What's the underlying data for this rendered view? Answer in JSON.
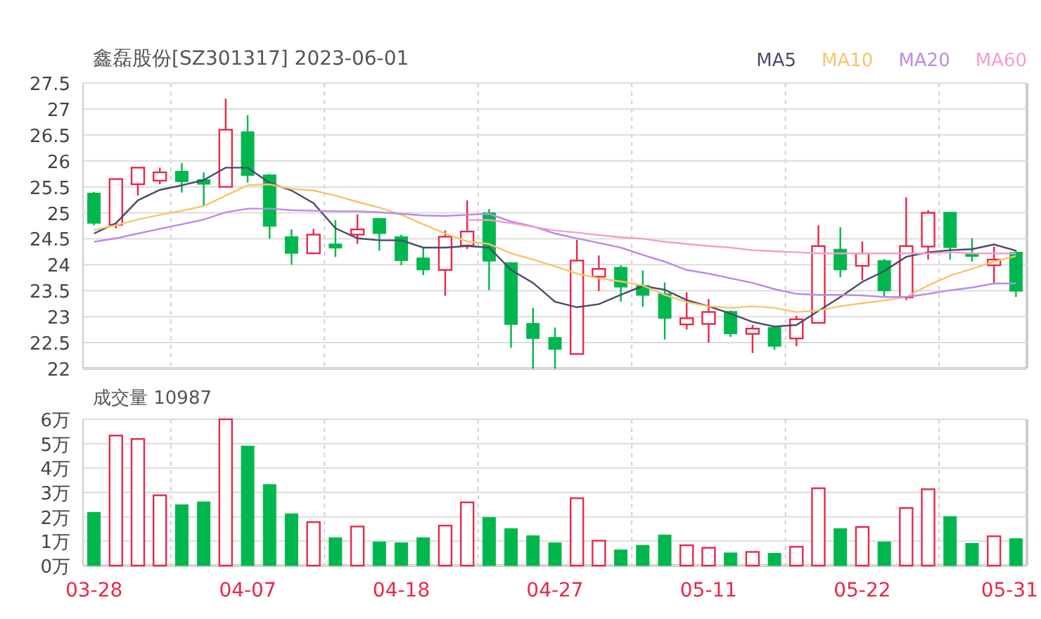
{
  "title": "鑫磊股份[SZ301317] 2023-06-01",
  "price_chart": {
    "chart_data": {
      "type": "candlestick",
      "grid": true,
      "ylim": [
        22,
        27.5
      ],
      "yticks": [
        22,
        22.5,
        23,
        23.5,
        24,
        24.5,
        25,
        25.5,
        26,
        26.5,
        27,
        27.5
      ],
      "categories": [
        null,
        null,
        null,
        null,
        null,
        null,
        null,
        null,
        null,
        null,
        null,
        null,
        null,
        null,
        null,
        null,
        null,
        null,
        null,
        null,
        null,
        null,
        null,
        null,
        null,
        null,
        null,
        null,
        null,
        null,
        null,
        null,
        null,
        null,
        null,
        null,
        null,
        null,
        null,
        null,
        null,
        null,
        null
      ],
      "ohlc": [
        [
          25.38,
          25.4,
          24.76,
          24.8
        ],
        [
          24.77,
          25.66,
          24.7,
          25.65
        ],
        [
          25.55,
          25.88,
          25.33,
          25.87
        ],
        [
          25.62,
          25.87,
          25.55,
          25.78
        ],
        [
          25.8,
          25.96,
          25.39,
          25.6
        ],
        [
          25.64,
          25.78,
          25.13,
          25.55
        ],
        [
          25.5,
          27.2,
          25.5,
          26.6
        ],
        [
          26.56,
          26.88,
          25.58,
          25.72
        ],
        [
          25.73,
          25.75,
          24.5,
          24.74
        ],
        [
          24.54,
          24.68,
          24.0,
          24.22
        ],
        [
          24.22,
          24.69,
          24.22,
          24.58
        ],
        [
          24.4,
          24.86,
          24.15,
          24.32
        ],
        [
          24.58,
          24.97,
          24.4,
          24.68
        ],
        [
          24.89,
          24.9,
          24.27,
          24.6
        ],
        [
          24.54,
          24.58,
          23.99,
          24.08
        ],
        [
          24.13,
          24.33,
          23.8,
          23.9
        ],
        [
          23.9,
          24.66,
          23.4,
          24.54
        ],
        [
          24.37,
          25.24,
          24.3,
          24.64
        ],
        [
          25.0,
          25.07,
          23.51,
          24.07
        ],
        [
          24.04,
          24.04,
          22.4,
          22.85
        ],
        [
          22.87,
          23.17,
          22.0,
          22.58
        ],
        [
          22.6,
          22.79,
          22.0,
          22.37
        ],
        [
          22.28,
          24.48,
          22.28,
          24.08
        ],
        [
          23.77,
          24.18,
          23.49,
          23.92
        ],
        [
          23.95,
          23.99,
          23.29,
          23.57
        ],
        [
          23.6,
          23.89,
          23.19,
          23.41
        ],
        [
          23.44,
          23.66,
          22.56,
          22.97
        ],
        [
          22.85,
          23.47,
          22.75,
          22.97
        ],
        [
          22.86,
          23.34,
          22.5,
          23.09
        ],
        [
          23.1,
          23.12,
          22.61,
          22.67
        ],
        [
          22.67,
          22.84,
          22.3,
          22.77
        ],
        [
          22.79,
          22.79,
          22.36,
          22.43
        ],
        [
          22.58,
          23.02,
          22.43,
          22.95
        ],
        [
          22.88,
          24.76,
          22.88,
          24.36
        ],
        [
          24.3,
          24.72,
          23.76,
          23.9
        ],
        [
          23.98,
          24.45,
          23.7,
          24.22
        ],
        [
          24.08,
          24.11,
          23.39,
          23.5
        ],
        [
          23.37,
          25.3,
          23.32,
          24.36
        ],
        [
          24.35,
          25.05,
          24.1,
          25.0
        ],
        [
          25.01,
          25.01,
          24.1,
          24.33
        ],
        [
          24.21,
          24.51,
          24.06,
          24.16
        ],
        [
          23.99,
          24.35,
          23.65,
          24.1
        ],
        [
          24.24,
          24.28,
          23.38,
          23.49
        ]
      ]
    }
  },
  "moving_averages": {
    "chart_data": {
      "type": "line",
      "ylim": [
        22,
        27.5
      ],
      "categories": [
        null,
        null,
        null,
        null,
        null,
        null,
        null,
        null,
        null,
        null,
        null,
        null,
        null,
        null,
        null,
        null,
        null,
        null,
        null,
        null,
        null,
        null,
        null,
        null,
        null,
        null,
        null,
        null,
        null,
        null,
        null,
        null,
        null,
        null,
        null,
        null,
        null,
        null,
        null,
        null,
        null,
        null,
        null
      ],
      "series": [
        {
          "name": "MA5",
          "color": "#4b4a6b",
          "values": [
            24.6,
            24.8,
            25.24,
            25.44,
            25.53,
            25.63,
            25.87,
            25.87,
            25.58,
            25.43,
            25.19,
            24.7,
            24.51,
            24.47,
            24.47,
            24.33,
            24.33,
            24.36,
            24.33,
            23.9,
            23.65,
            23.29,
            23.18,
            23.24,
            23.42,
            23.59,
            23.52,
            23.32,
            23.2,
            23.06,
            22.9,
            22.81,
            22.84,
            23.11,
            23.38,
            23.67,
            23.88,
            24.15,
            24.24,
            24.28,
            24.3,
            24.39,
            24.27
          ]
        },
        {
          "name": "MA10",
          "color": "#f7c46c",
          "values": [
            24.67,
            24.76,
            24.87,
            24.96,
            25.04,
            25.13,
            25.33,
            25.53,
            25.55,
            25.46,
            25.43,
            25.33,
            25.21,
            25.1,
            24.96,
            24.78,
            24.6,
            24.45,
            24.4,
            24.22,
            24.1,
            23.97,
            23.83,
            23.74,
            23.68,
            23.6,
            23.42,
            23.28,
            23.2,
            23.17,
            23.2,
            23.17,
            23.09,
            23.12,
            23.2,
            23.26,
            23.31,
            23.38,
            23.6,
            23.79,
            23.92,
            24.06,
            24.17
          ]
        },
        {
          "name": "MA20",
          "color": "#b98be6",
          "values": [
            24.44,
            24.51,
            24.6,
            24.69,
            24.78,
            24.87,
            25.01,
            25.08,
            25.08,
            25.05,
            25.04,
            25.03,
            25.03,
            25.01,
            24.98,
            24.95,
            24.94,
            24.96,
            24.98,
            24.83,
            24.74,
            24.6,
            24.51,
            24.42,
            24.33,
            24.19,
            24.06,
            23.9,
            23.83,
            23.74,
            23.65,
            23.53,
            23.44,
            23.42,
            23.42,
            23.41,
            23.38,
            23.38,
            23.44,
            23.51,
            23.56,
            23.64,
            23.64
          ]
        },
        {
          "name": "MA60",
          "color": "#f59dcb",
          "values": [
            null,
            null,
            null,
            null,
            null,
            null,
            null,
            null,
            null,
            null,
            null,
            null,
            null,
            null,
            null,
            null,
            null,
            24.86,
            24.86,
            24.8,
            24.73,
            24.66,
            24.62,
            24.57,
            24.53,
            24.5,
            24.44,
            24.4,
            24.36,
            24.33,
            24.28,
            24.26,
            24.24,
            24.22,
            24.22,
            24.22,
            24.22,
            24.22,
            24.22,
            24.24,
            24.22,
            24.22,
            24.22
          ]
        }
      ]
    }
  },
  "volume_chart": {
    "label": "成交量 10987",
    "chart_data": {
      "type": "bar",
      "grid": true,
      "ylim": [
        0,
        6
      ],
      "yticks": [
        {
          "value": 0,
          "label": "0万"
        },
        {
          "value": 1,
          "label": "1万"
        },
        {
          "value": 2,
          "label": "2万"
        },
        {
          "value": 3,
          "label": "3万"
        },
        {
          "value": 4,
          "label": "4万"
        },
        {
          "value": 5,
          "label": "5万"
        },
        {
          "value": 6,
          "label": "6万"
        }
      ],
      "categories": [
        "03-28",
        null,
        null,
        null,
        null,
        null,
        null,
        "04-07",
        null,
        null,
        null,
        null,
        null,
        null,
        "04-18",
        null,
        null,
        null,
        null,
        null,
        null,
        "04-27",
        null,
        null,
        null,
        null,
        null,
        null,
        "05-11",
        null,
        null,
        null,
        null,
        null,
        null,
        "05-22",
        null,
        null,
        null,
        null,
        null,
        null,
        "05-31"
      ],
      "values": [
        2.18,
        5.33,
        5.19,
        2.88,
        2.49,
        2.61,
        6.0,
        4.9,
        3.32,
        2.12,
        1.78,
        1.14,
        1.6,
        0.97,
        0.93,
        1.14,
        1.64,
        2.59,
        1.97,
        1.51,
        1.22,
        0.93,
        2.76,
        1.02,
        0.64,
        0.83,
        1.25,
        0.83,
        0.73,
        0.52,
        0.56,
        0.5,
        0.77,
        3.17,
        1.51,
        1.58,
        0.97,
        2.36,
        3.13,
        2.01,
        0.91,
        1.2,
        1.1
      ]
    }
  }
}
